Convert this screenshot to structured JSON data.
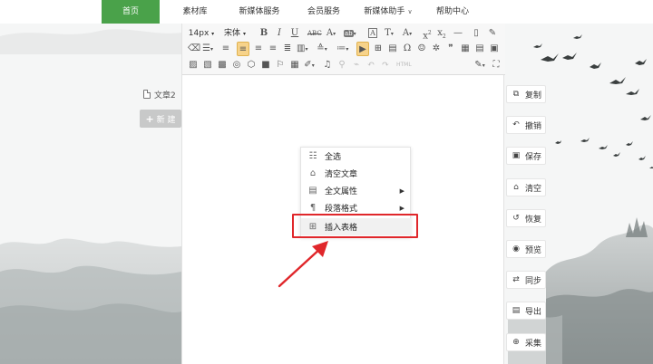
{
  "nav": {
    "items": [
      {
        "label": "首页",
        "active": true
      },
      {
        "label": "素材库"
      },
      {
        "label": "新媒体服务"
      },
      {
        "label": "会员服务"
      },
      {
        "label": "新媒体助手",
        "has_dropdown": true
      },
      {
        "label": "帮助中心"
      }
    ],
    "accent": "#4aa24a"
  },
  "doc": {
    "tab_label": "文章2",
    "new_button": "新 建"
  },
  "toolbar": {
    "font_size": "14px",
    "font_family": "宋体",
    "html_label": "HTML"
  },
  "context_menu": {
    "items": [
      {
        "label": "全选",
        "icon": "select-all-icon"
      },
      {
        "label": "清空文章",
        "icon": "clear-icon"
      },
      {
        "label": "全文属性",
        "icon": "properties-icon",
        "submenu": true
      },
      {
        "label": "段落格式",
        "icon": "paragraph-icon",
        "submenu": true
      },
      {
        "label": "插入表格",
        "icon": "table-icon",
        "highlighted": true
      }
    ],
    "highlight_color": "#e0272b"
  },
  "side_actions": [
    {
      "label": "复制",
      "icon": "copy-icon"
    },
    {
      "label": "撤销",
      "icon": "undo-icon"
    },
    {
      "label": "保存",
      "icon": "save-icon"
    },
    {
      "label": "清空",
      "icon": "clear-icon"
    },
    {
      "label": "恢复",
      "icon": "restore-icon"
    },
    {
      "label": "预览",
      "icon": "eye-icon"
    },
    {
      "label": "同步",
      "icon": "sync-icon"
    },
    {
      "label": "导出",
      "icon": "export-icon"
    },
    {
      "label": "采集",
      "icon": "collect-icon"
    }
  ]
}
